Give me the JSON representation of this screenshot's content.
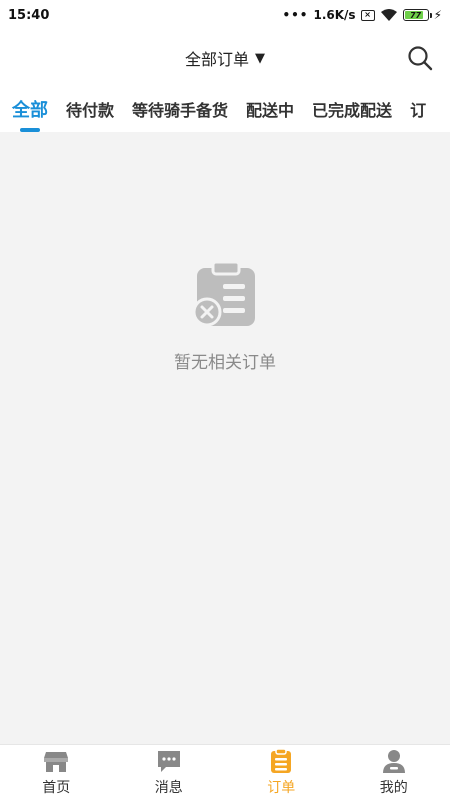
{
  "status_bar": {
    "time": "15:40",
    "dots": "•••",
    "speed": "1.6K/s",
    "battery": "77",
    "charging": "⚡"
  },
  "header": {
    "title": "全部订单",
    "caret": "▼"
  },
  "tabs": [
    {
      "label": "全部",
      "active": true
    },
    {
      "label": "待付款"
    },
    {
      "label": "等待骑手备货"
    },
    {
      "label": "配送中"
    },
    {
      "label": "已完成配送"
    },
    {
      "label": "订"
    }
  ],
  "empty_state": {
    "message": "暂无相关订单"
  },
  "bottom_nav": [
    {
      "label": "首页",
      "icon": "store-icon"
    },
    {
      "label": "消息",
      "icon": "message-icon"
    },
    {
      "label": "订单",
      "icon": "orders-icon",
      "active": true
    },
    {
      "label": "我的",
      "icon": "profile-icon"
    }
  ],
  "colors": {
    "accent": "#1a8fd8",
    "nav_active": "#f5a623",
    "background": "#f3f3f3",
    "empty_icon": "#bdbdbd"
  }
}
